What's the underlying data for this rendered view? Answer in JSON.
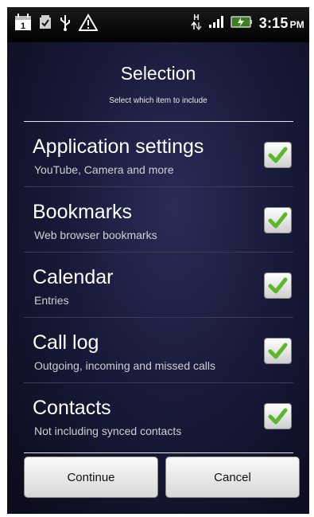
{
  "status_bar": {
    "time": "3:15",
    "ampm": "PM",
    "network_type": "H",
    "icons": [
      "calendar-icon",
      "checkbox-notification-icon",
      "usb-icon",
      "warning-icon",
      "data-transfer-icon",
      "signal-icon",
      "battery-icon"
    ]
  },
  "dialog": {
    "title": "Selection",
    "subtitle": "Select which item to include",
    "items": [
      {
        "label": "Application settings",
        "description": "YouTube, Camera and more",
        "checked": true
      },
      {
        "label": "Bookmarks",
        "description": "Web browser bookmarks",
        "checked": true
      },
      {
        "label": "Calendar",
        "description": "Entries",
        "checked": true
      },
      {
        "label": "Call log",
        "description": "Outgoing, incoming and missed calls",
        "checked": true
      },
      {
        "label": "Contacts",
        "description": "Not including synced contacts",
        "checked": true
      }
    ],
    "buttons": {
      "continue": "Continue",
      "cancel": "Cancel"
    }
  },
  "colors": {
    "accent_check": "#5cb82a",
    "background": "#191a3a"
  }
}
